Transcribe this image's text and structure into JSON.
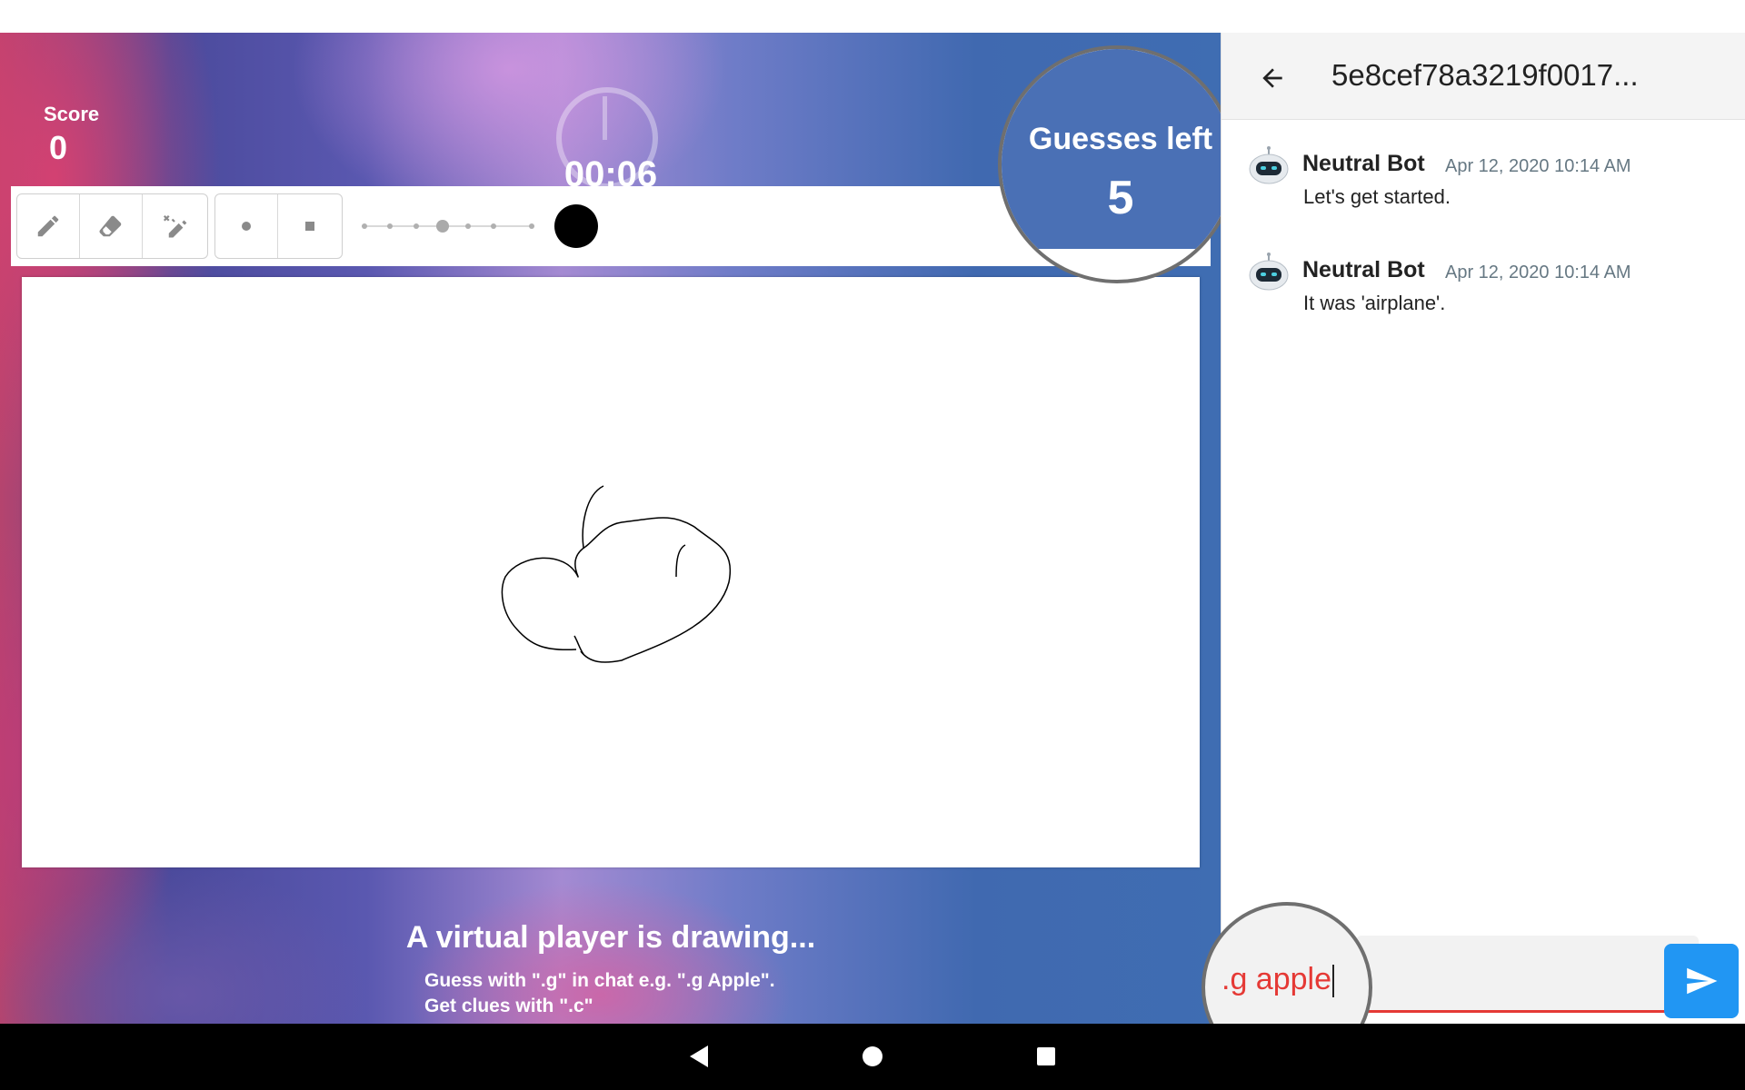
{
  "game": {
    "score_label": "Score",
    "score_value": "0",
    "timer": "00:06",
    "guesses_label": "Guesses left",
    "guesses_value": "5",
    "status_title": "A virtual player is drawing...",
    "hint_line1": "Guess with \".g\" in chat e.g. \".g Apple\".",
    "hint_line2": "Get clues with \".c\"",
    "toolbar": {
      "tools": [
        "pencil-icon",
        "eraser-icon",
        "magic-wand-icon"
      ],
      "shapes": [
        "round-brush-icon",
        "square-brush-icon"
      ],
      "brush_sizes": 7,
      "selected_brush_size_index": 3,
      "color": "#000000"
    }
  },
  "chat": {
    "title": "5e8cef78a3219f0017...",
    "messages": [
      {
        "author": "Neutral Bot",
        "time": "Apr 12, 2020 10:14 AM",
        "text": "Let's get started."
      },
      {
        "author": "Neutral Bot",
        "time": "Apr 12, 2020 10:14 AM",
        "text": "It was 'airplane'."
      }
    ],
    "input_value": ".g apple",
    "send_icon": "send-icon"
  },
  "colors": {
    "accent": "#2196f3",
    "error": "#e53935",
    "guesses_bg": "#4a70b5",
    "timestamp": "#667883"
  },
  "navbar": [
    "back-triangle-icon",
    "home-circle-icon",
    "recents-square-icon"
  ]
}
